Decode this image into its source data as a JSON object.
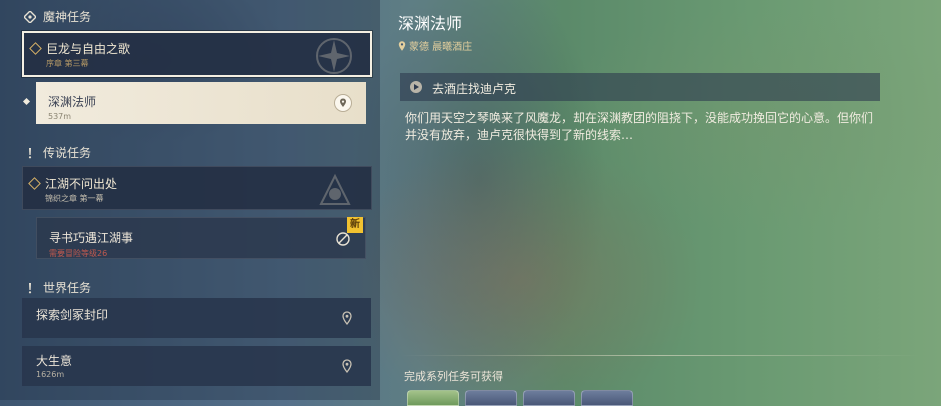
{
  "left_panel": {
    "categories": {
      "archon": "魔神任务",
      "story": "传说任务",
      "world": "世界任务"
    },
    "archon_quest": {
      "title": "巨龙与自由之歌",
      "subtitle": "序章 第三幕"
    },
    "archon_sub": {
      "title": "深渊法师",
      "distance": "537m"
    },
    "story_quest": {
      "title": "江湖不问出处",
      "subtitle": "锦织之章 第一幕"
    },
    "story_sub": {
      "title": "寻书巧遇江湖事",
      "requirement": "需要冒险等级26",
      "new_badge": "新"
    },
    "world_quests": [
      {
        "title": "探索剑冢封印"
      },
      {
        "title": "大生意",
        "distance": "1626m"
      }
    ]
  },
  "detail": {
    "title": "深渊法师",
    "location": "蒙德 晨曦酒庄",
    "current_step": "去酒庄找迪卢克",
    "description": "你们用天空之琴唤来了风魔龙，却在深渊教团的阻挠下，没能成功挽回它的心意。但你们并没有放弃，迪卢克很快得到了新的线索…",
    "reward_label": "完成系列任务可获得"
  },
  "colors": {
    "accent_gold": "#d9b267",
    "selected_card": "#ece5d8",
    "card_dark": "#24304a",
    "locked_red": "#c0594e",
    "new_badge": "#f2c230"
  },
  "icons": [
    "quest-diamond-icon",
    "archon-category-icon",
    "exclamation-icon",
    "location-pin-icon",
    "play-arrow-icon",
    "locked-icon"
  ]
}
